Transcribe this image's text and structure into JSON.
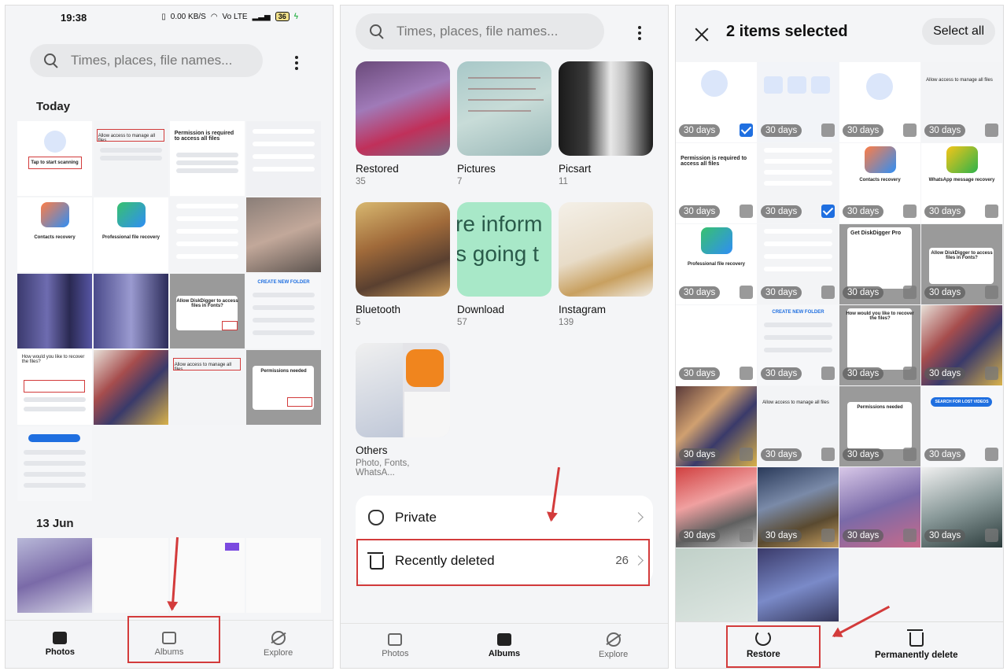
{
  "panel1": {
    "status": {
      "time": "19:38",
      "net": "0.00 KB/S",
      "carrier": "Vo LTE",
      "battery": "36"
    },
    "search_placeholder": "Times, places, file names...",
    "today_label": "Today",
    "date2_label": "13 Jun",
    "tiles": {
      "tap_to_start": "Tap to start scanning",
      "allow_access": "Allow access to manage all files",
      "permission_required": "Permission is required to access all files",
      "contacts_recovery": "Contacts recovery",
      "professional_recovery": "Professional file recovery",
      "allow_diskdigger": "Allow DiskDigger to access files in Fonts?",
      "permissions_needed": "Permissions needed",
      "how_recover": "How would you like to recover the files?",
      "create_folder": "CREATE NEW FOLDER"
    },
    "nav": [
      {
        "label": "Photos",
        "active": true
      },
      {
        "label": "Albums",
        "active": false
      },
      {
        "label": "Explore",
        "active": false
      }
    ]
  },
  "panel2": {
    "search_placeholder": "Times, places, file names...",
    "albums": [
      {
        "name": "Restored",
        "count": "35"
      },
      {
        "name": "Pictures",
        "count": "7"
      },
      {
        "name": "Picsart",
        "count": "11"
      },
      {
        "name": "Bluetooth",
        "count": "5"
      },
      {
        "name": "Download",
        "count": "57"
      },
      {
        "name": "Instagram",
        "count": "139"
      },
      {
        "name": "Others",
        "count": "Photo, Fonts, WhatsA..."
      }
    ],
    "download_thumb_text": [
      "re inform",
      "s going t"
    ],
    "rows": [
      {
        "label": "Private",
        "count": ""
      },
      {
        "label": "Recently deleted",
        "count": "26"
      }
    ],
    "nav": [
      {
        "label": "Photos",
        "active": false
      },
      {
        "label": "Albums",
        "active": true
      },
      {
        "label": "Explore",
        "active": false
      }
    ]
  },
  "panel3": {
    "title": "2 items selected",
    "select_all": "Select all",
    "days_label": "30 days",
    "tile_titles": {
      "contacts": "Contacts recovery",
      "whatsapp": "WhatsApp message recovery",
      "permission": "Permission is required to access all files",
      "professional": "Professional file recovery",
      "get_pro": "Get DiskDigger Pro",
      "allow_fonts": "Allow DiskDigger to access files in Fonts?",
      "permissions_needed": "Permissions needed",
      "how_recover": "How would you like to recover the files?",
      "search_lost": "SEARCH FOR LOST VIDEOS"
    },
    "actions": [
      {
        "label": "Restore"
      },
      {
        "label": "Permanently delete"
      }
    ]
  },
  "colors": {
    "accent": "#d33b3b",
    "check": "#1f6fe0",
    "bg": "#f4f5f7"
  }
}
